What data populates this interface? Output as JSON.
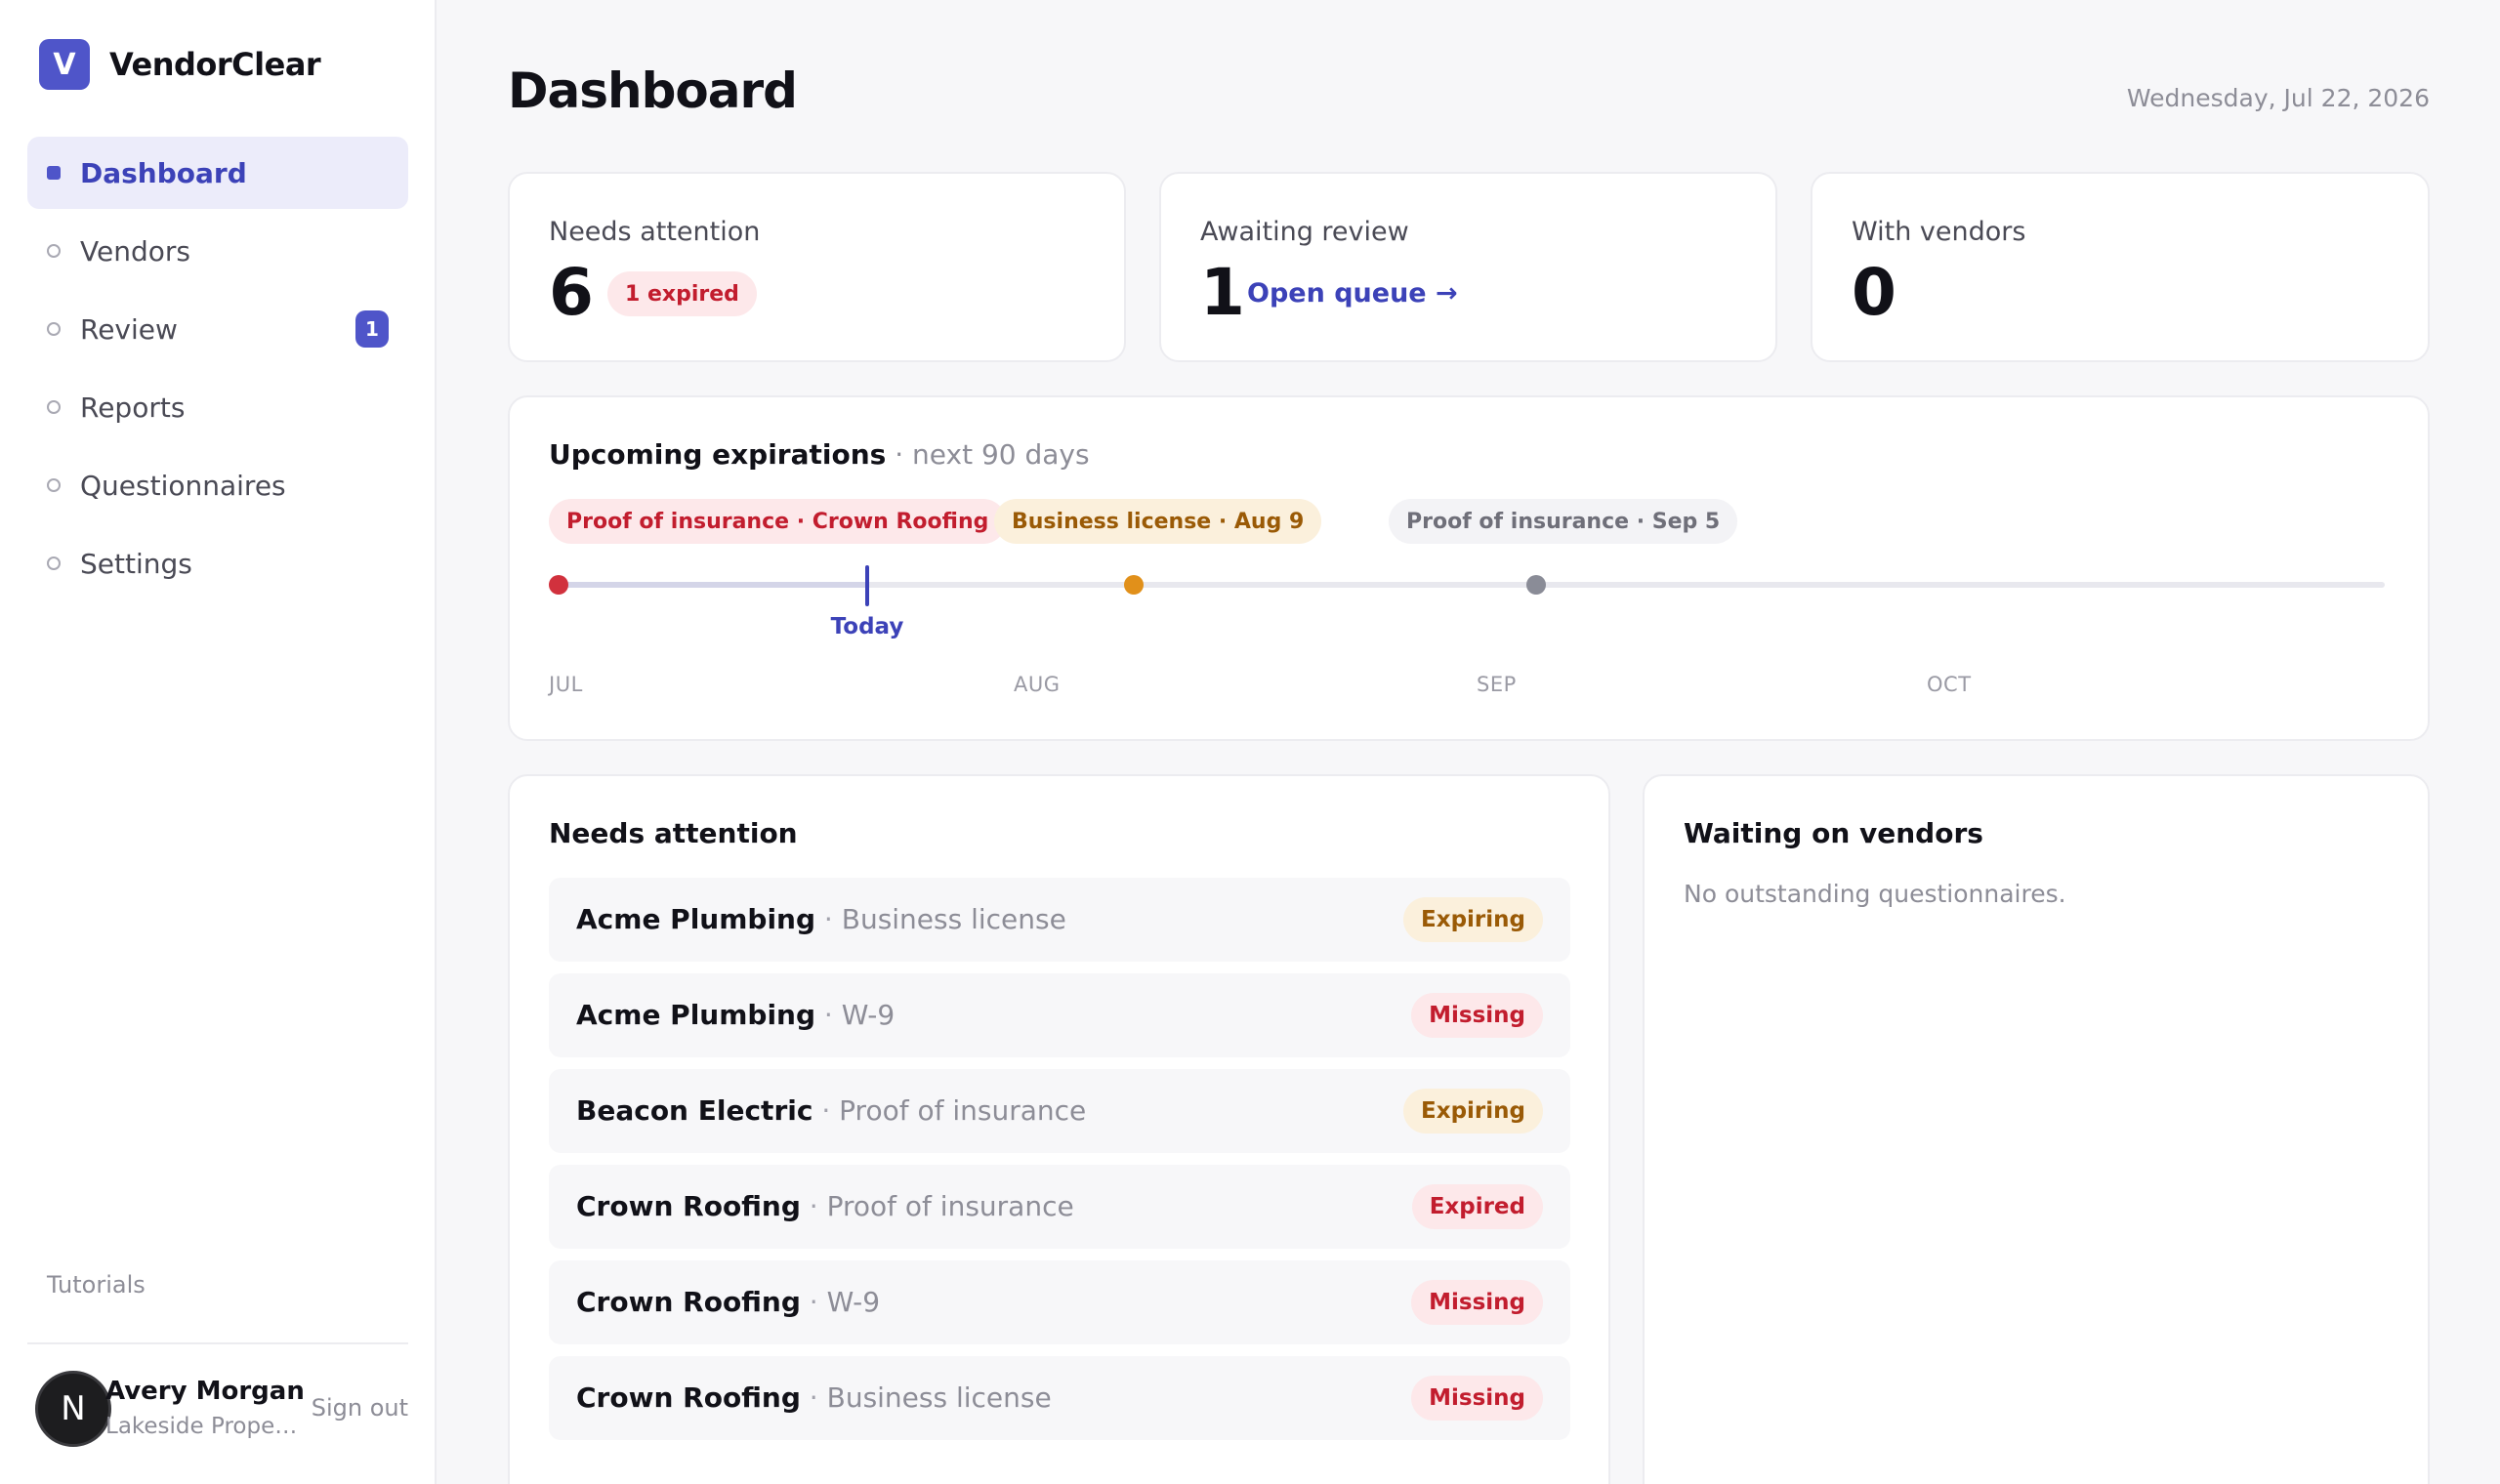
{
  "app": {
    "logo_letter": "V",
    "name": "VendorClear"
  },
  "nav": {
    "items": [
      {
        "label": "Dashboard",
        "active": true
      },
      {
        "label": "Vendors"
      },
      {
        "label": "Review",
        "badge": "1"
      },
      {
        "label": "Reports"
      },
      {
        "label": "Questionnaires"
      },
      {
        "label": "Settings"
      }
    ],
    "tutorials": "Tutorials"
  },
  "user": {
    "initial": "N",
    "name": "Avery Morgan",
    "org": "Lakeside Proper...",
    "sign_out": "Sign out"
  },
  "header": {
    "title": "Dashboard",
    "date": "Wednesday, Jul 22, 2026"
  },
  "stats": {
    "needs_attention": {
      "label": "Needs attention",
      "value": "6",
      "pill": "1 expired"
    },
    "awaiting_review": {
      "label": "Awaiting review",
      "value": "1",
      "link": "Open queue →"
    },
    "with_vendors": {
      "label": "With vendors",
      "value": "0"
    }
  },
  "timeline": {
    "title": "Upcoming expirations",
    "subtitle": " · next 90 days",
    "events": [
      {
        "label": "Proof of insurance · Crown Roofing",
        "tone": "red",
        "color": "#d1313d"
      },
      {
        "label": "Business license · Aug 9",
        "tone": "amber",
        "color": "#e1901a"
      },
      {
        "label": "Proof of insurance · Sep 5",
        "tone": "gray",
        "color": "#8a8c97"
      }
    ],
    "today_label": "Today",
    "months": [
      "JUL",
      "AUG",
      "SEP",
      "OCT"
    ]
  },
  "needs_attention": {
    "title": "Needs attention",
    "rows": [
      {
        "vendor": "Acme Plumbing",
        "doc": "Business license",
        "status": "Expiring"
      },
      {
        "vendor": "Acme Plumbing",
        "doc": "W-9",
        "status": "Missing"
      },
      {
        "vendor": "Beacon Electric",
        "doc": "Proof of insurance",
        "status": "Expiring"
      },
      {
        "vendor": "Crown Roofing",
        "doc": "Proof of insurance",
        "status": "Expired"
      },
      {
        "vendor": "Crown Roofing",
        "doc": "W-9",
        "status": "Missing"
      },
      {
        "vendor": "Crown Roofing",
        "doc": "Business license",
        "status": "Missing"
      }
    ]
  },
  "waiting": {
    "title": "Waiting on vendors",
    "empty": "No outstanding questionnaires."
  },
  "colors": {
    "accent": "#4f55c9",
    "accent_text": "#3c42b8",
    "danger": "#c21d2e",
    "warning": "#9a5a06"
  }
}
